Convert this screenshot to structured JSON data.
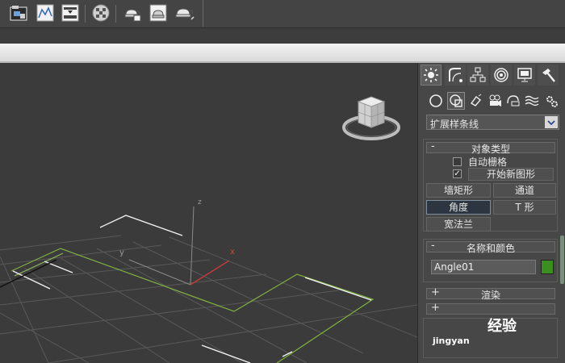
{
  "toolbar": {
    "icons": [
      "layer-manager-icon",
      "curve-editor-icon",
      "schematic-view-icon",
      "material-editor-icon",
      "render-setup-icon",
      "rendered-frame-icon",
      "render-production-icon"
    ]
  },
  "viewport": {
    "axis_labels": {
      "x": "x",
      "y": "y",
      "z": "z"
    }
  },
  "panel": {
    "tabs": [
      "create-tab",
      "modify-tab",
      "hierarchy-tab",
      "motion-tab",
      "display-tab",
      "utilities-tab"
    ],
    "categories": [
      "geometry",
      "shapes",
      "lights",
      "cameras",
      "helpers",
      "space-warps",
      "systems"
    ],
    "dropdown": {
      "selected": "扩展样条线"
    },
    "object_type": {
      "title": "对象类型",
      "collapse_sign": "-",
      "autogrid_label": "自动栅格",
      "start_new_shape_label": "开始新图形",
      "start_new_shape_checked": true,
      "buttons": [
        "墙矩形",
        "通道",
        "角度",
        "T 形",
        "宽法兰"
      ],
      "active_button": "角度"
    },
    "name_color": {
      "title": "名称和颜色",
      "collapse_sign": "-",
      "name_value": "Angle01",
      "swatch_color": "#3a8f1f"
    },
    "render_rollout": {
      "title": "渲染",
      "sign": "+"
    },
    "interp_rollout": {
      "sign": "+"
    }
  },
  "watermark": {
    "text": "经验",
    "subtext": "jingyan"
  },
  "colors": {
    "accent_x_axis": "#c23a3a",
    "shape_line": "#7fb040",
    "grid": "#5a5a5a",
    "highlight_edge": "#f0f0f0"
  }
}
